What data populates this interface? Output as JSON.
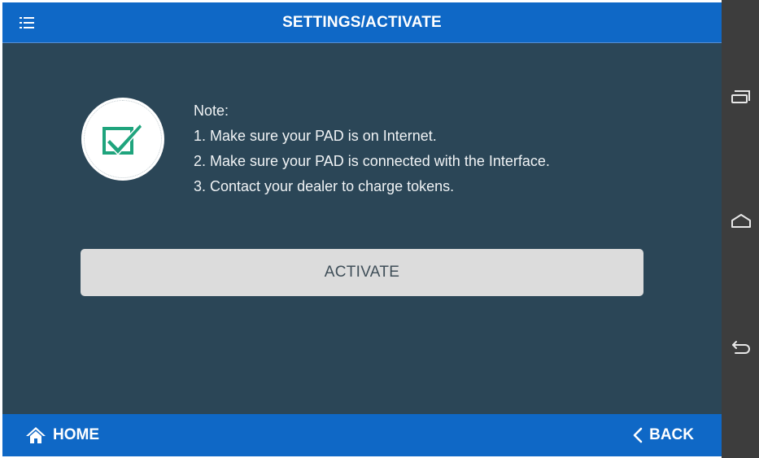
{
  "header": {
    "title": "SETTINGS/ACTIVATE",
    "menu_icon": "menu-icon"
  },
  "note": {
    "heading": "Note:",
    "lines": [
      "1. Make sure your PAD is on Internet.",
      "2. Make sure your PAD is connected with the Interface.",
      "3. Contact your dealer to charge tokens."
    ],
    "badge_icon": "checkbox-check-icon"
  },
  "activate_button": {
    "label": "ACTIVATE"
  },
  "footer": {
    "home_label": "HOME",
    "home_icon": "home-icon",
    "back_label": "BACK",
    "back_icon": "chevron-left-icon"
  },
  "system_nav": {
    "buttons": [
      "recents-icon",
      "home-outline-icon",
      "back-arrow-icon"
    ]
  },
  "colors": {
    "bar_blue": "#0f68c6",
    "panel_bg": "#2b4657",
    "button_bg": "#dcdcdc",
    "check_green": "#1fa47d",
    "system_nav_bg": "#3d3d3d"
  }
}
